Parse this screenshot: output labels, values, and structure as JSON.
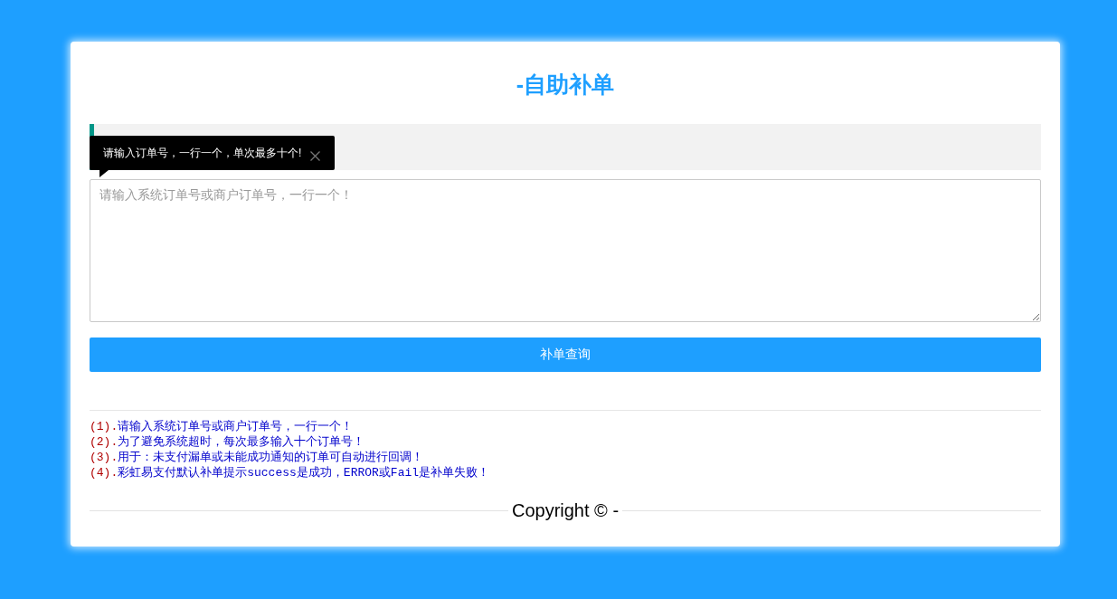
{
  "page": {
    "title": "-自助补单"
  },
  "tooltip": {
    "text": "请输入订单号，一行一个，单次最多十个!"
  },
  "order_input": {
    "placeholder": "请输入系统订单号或商户订单号，一行一个！"
  },
  "submit_button": {
    "label": "补单查询"
  },
  "notes": [
    {
      "number": "(1).",
      "text": "请输入系统订单号或商户订单号，一行一个！"
    },
    {
      "number": "(2).",
      "text": "为了避免系统超时，每次最多输入十个订单号！"
    },
    {
      "number": "(3).",
      "text": "用于：未支付漏单或未能成功通知的订单可自动进行回调！"
    },
    {
      "number": "(4).",
      "text": "彩虹易支付默认补单提示success是成功，ERROR或Fail是补单失败！"
    }
  ],
  "footer": {
    "copyright": "Copyright © -"
  }
}
